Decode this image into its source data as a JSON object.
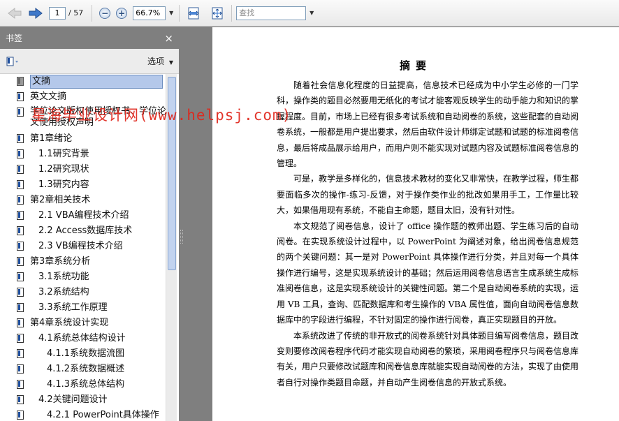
{
  "toolbar": {
    "current_page": "1",
    "page_total": "/ 57",
    "zoom": "66.7%",
    "search_placeholder": "查找"
  },
  "panel": {
    "title": "书签",
    "close": "×",
    "options_label": "选项",
    "bookmarks": [
      {
        "label": "文摘",
        "level": 0,
        "selected": true
      },
      {
        "label": "英文文摘",
        "level": 0
      },
      {
        "label": "学位论文版权使用授权书、学位论文使用授权声明",
        "level": 0,
        "two_line": true
      },
      {
        "label": "第1章绪论",
        "level": 0
      },
      {
        "label": "1.1研究背景",
        "level": 1
      },
      {
        "label": "1.2研究现状",
        "level": 1
      },
      {
        "label": "1.3研究内容",
        "level": 1
      },
      {
        "label": "第2章相关技术",
        "level": 0
      },
      {
        "label": "2.1 VBA编程技术介绍",
        "level": 1
      },
      {
        "label": "2.2 Access数据库技术",
        "level": 1
      },
      {
        "label": "2.3 VB编程技术介绍",
        "level": 1
      },
      {
        "label": "第3章系统分析",
        "level": 0
      },
      {
        "label": "3.1系统功能",
        "level": 1
      },
      {
        "label": "3.2系统结构",
        "level": 1
      },
      {
        "label": "3.3系统工作原理",
        "level": 1
      },
      {
        "label": "第4章系统设计实现",
        "level": 0
      },
      {
        "label": "4.1系统总体结构设计",
        "level": 1
      },
      {
        "label": "4.1.1系统数据流图",
        "level": 2
      },
      {
        "label": "4.1.2系统数据概述",
        "level": 2
      },
      {
        "label": "4.1.3系统总体结构",
        "level": 2
      },
      {
        "label": "4.2关键问题设计",
        "level": 1
      },
      {
        "label": "4.2.1 PowerPoint具体操作",
        "level": 2
      }
    ]
  },
  "watermark": "星海毕业设计网(www.helpsj.com)",
  "document": {
    "title": "摘要",
    "paragraphs": [
      "随着社会信息化程度的日益提高，信息技术已经成为中小学生必修的一门学科，操作类的题目必然要用无纸化的考试才能客观反映学生的动手能力和知识的掌握程度。目前，市场上已经有很多考试系统和自动阅卷的系统，这些配套的自动阅卷系统，一般都是用户提出要求，然后由软件设计师绑定试题和试题的标准阅卷信息，最后将成品展示给用户，而用户则不能实现对试题内容及试题标准阅卷信息的管理。",
      "可是，教学是多样化的，信息技术教材的变化又非常快，在教学过程，师生都要面临多次的操作-练习-反馈，对于操作类作业的批改如果用手工，工作量比较大，如果借用现有系统，不能自主命题，题目太旧，没有针对性。",
      "本文规范了阅卷信息，设计了 office 操作题的教师出题、学生练习后的自动阅卷。在实现系统设计过程中，以 PowerPoint 为阐述对象，给出阅卷信息规范的两个关键问题：其一是对 PowerPoint 具体操作进行分类，并且对每一个具体操作进行编号，这是实现系统设计的基础；然后运用阅卷信息语言生成系统生成标准阅卷信息，这是实现系统设计的关键性问题。第二个是自动阅卷系统的实现，运用 VB 工具，查询、匹配数据库和考生操作的 VBA 属性值，面向自动阅卷信息数据库中的字段进行编程，不针对固定的操作进行阅卷，真正实现题目的开放。",
      "本系统改进了传统的非开放式的阅卷系统针对具体题目编写阅卷信息，题目改变则要修改阅卷程序代码才能实现自动阅卷的繁琐，采用阅卷程序只与阅卷信息库有关，用户只要修改试题库和阅卷信息库就能实现自动阅卷的方法，实现了由使用者自行对操作类题目命题，并自动产生阅卷信息的开放式系统。"
    ]
  }
}
